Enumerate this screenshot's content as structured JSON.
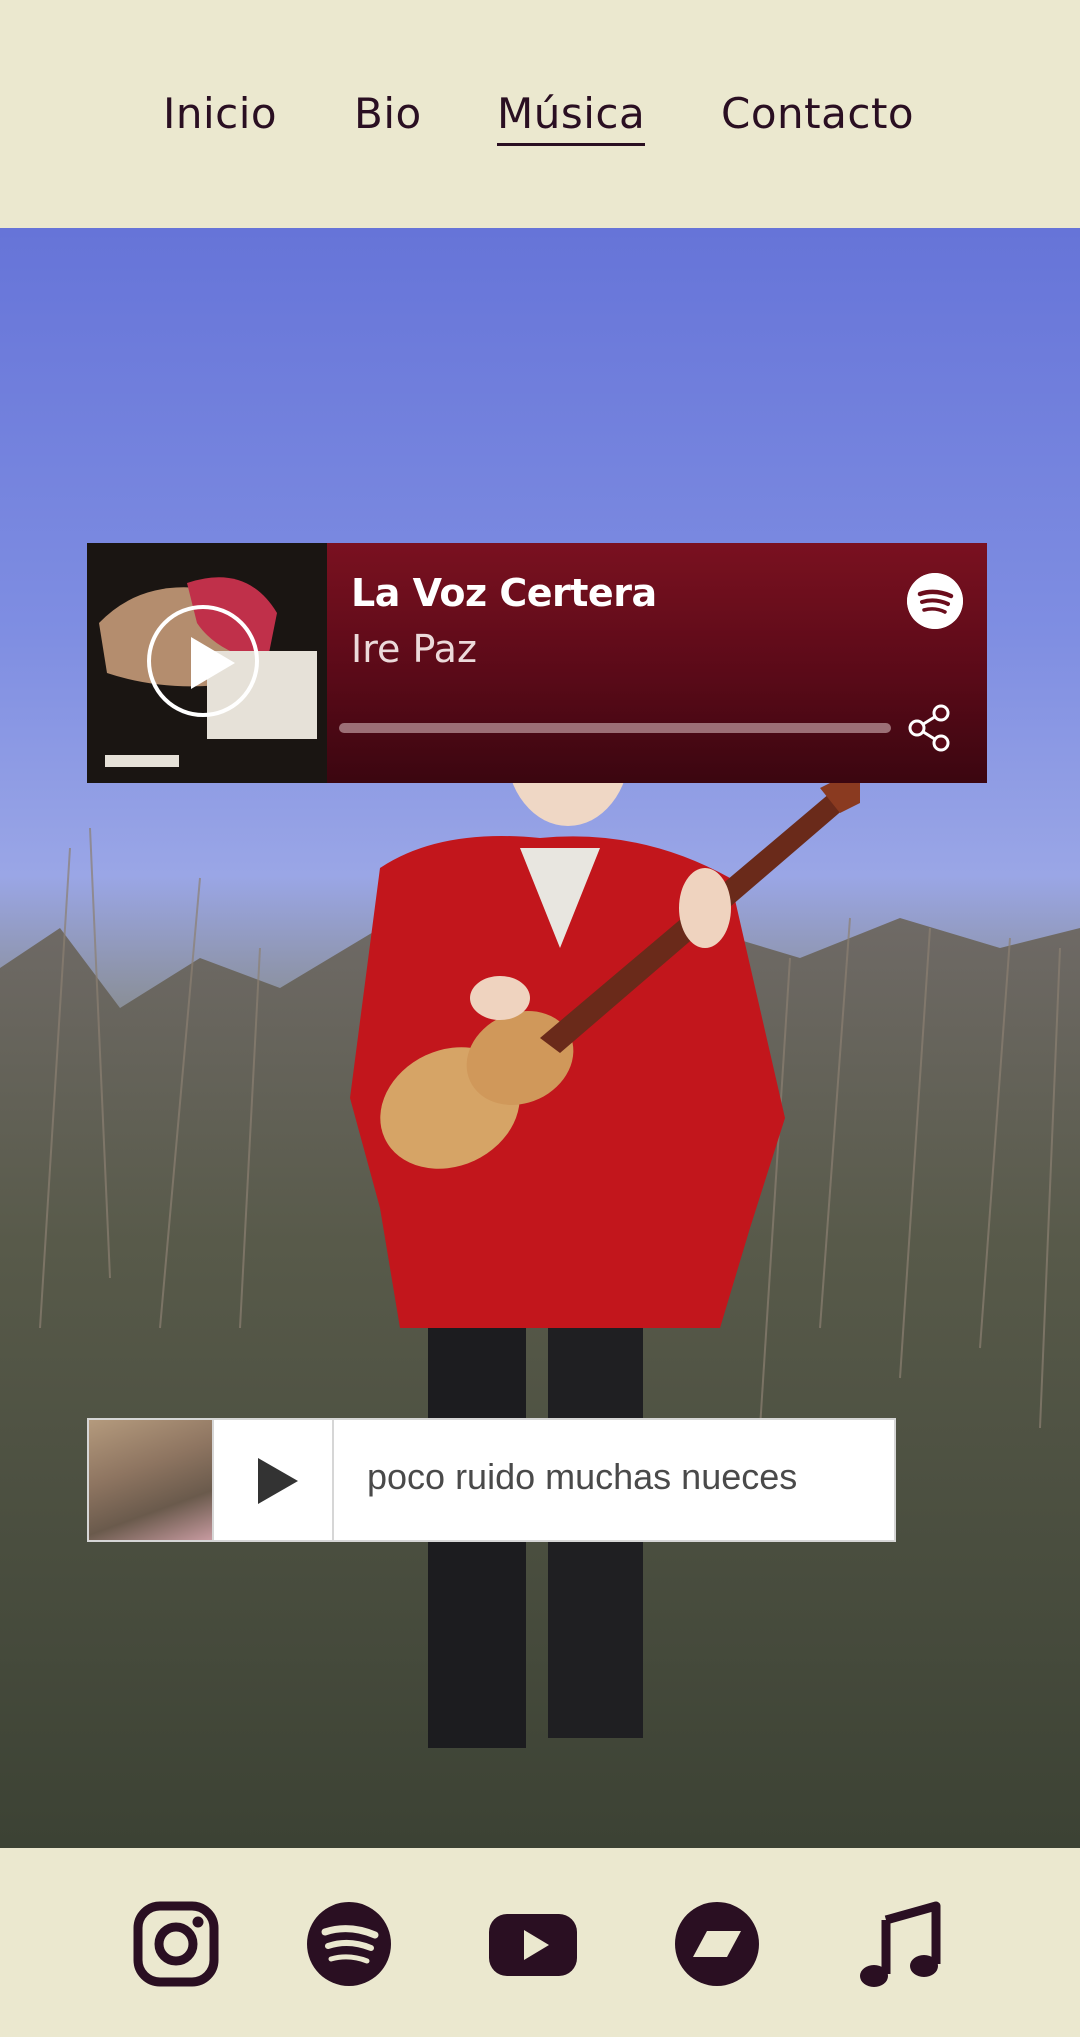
{
  "nav": {
    "items": [
      {
        "label": "Inicio",
        "active": false
      },
      {
        "label": "Bio",
        "active": false
      },
      {
        "label": "Música",
        "active": true
      },
      {
        "label": "Contacto",
        "active": false
      }
    ]
  },
  "spotify_player": {
    "track": "La Voz Certera",
    "artist": "Ire Paz",
    "bg_color": "#6a0d1c"
  },
  "soundcloud_player": {
    "title": "poco ruido muchas nueces"
  },
  "social": {
    "icons": [
      "instagram-icon",
      "spotify-icon",
      "youtube-icon",
      "bandcamp-icon",
      "music-note-icon"
    ],
    "color": "#2a0f22"
  }
}
